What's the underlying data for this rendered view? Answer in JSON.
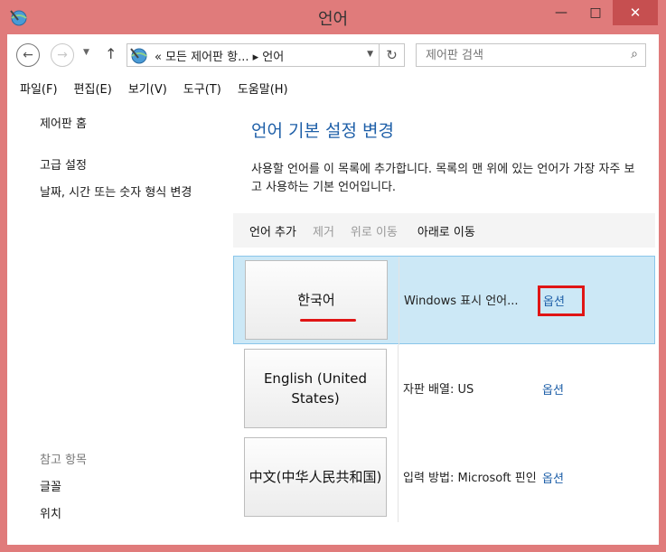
{
  "window": {
    "title": "언어"
  },
  "address": {
    "path": "« 모든 제어판 항... ▸ 언어"
  },
  "search": {
    "placeholder": "제어판 검색"
  },
  "menu": [
    "파일(F)",
    "편집(E)",
    "보기(V)",
    "도구(T)",
    "도움말(H)"
  ],
  "nav": {
    "home": "제어판 홈",
    "advanced": "고급 설정",
    "datetime": "날짜, 시간 또는 숫자 형식 변경",
    "see_also": "참고 항목",
    "fonts": "글꼴",
    "location": "위치"
  },
  "content": {
    "title": "언어 기본 설정 변경",
    "description": "사용할 언어를 이 목록에 추가합니다. 목록의 맨 위에 있는 언어가 가장 자주 보고 사용하는 기본 언어입니다."
  },
  "toolbar": {
    "add": "언어 추가",
    "remove": "제거",
    "move_up": "위로 이동",
    "move_down": "아래로 이동"
  },
  "languages": [
    {
      "name": "한국어",
      "status": "Windows 표시 언어...",
      "option": "옵션"
    },
    {
      "name": "English (United States)",
      "status": "자판 배열: US",
      "option": "옵션"
    },
    {
      "name": "中文(中华人民共和国)",
      "status": "입력 방법: Microsoft 핀인",
      "option": "옵션"
    }
  ],
  "colors": {
    "accent": "#1e5fa8",
    "titlebar": "#e07b7b",
    "selected_row": "#cce8f6",
    "annotation": "#e01515"
  }
}
